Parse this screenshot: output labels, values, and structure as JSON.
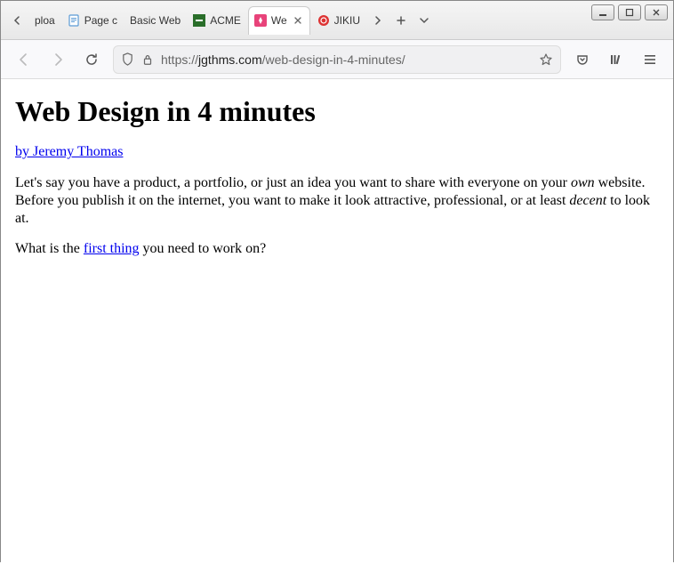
{
  "window": {
    "tabs": [
      {
        "label": "ploa",
        "favicon": "none"
      },
      {
        "label": "Page c",
        "favicon": "doc"
      },
      {
        "label": "Basic Web",
        "favicon": "none"
      },
      {
        "label": "ACME",
        "favicon": "acme"
      },
      {
        "label": "We",
        "favicon": "jt",
        "active": true
      },
      {
        "label": "JIKIU",
        "favicon": "spiral"
      }
    ]
  },
  "toolbar": {
    "url_prefix": "https://",
    "url_domain": "jgthms.com",
    "url_path": "/web-design-in-4-minutes/"
  },
  "page": {
    "title": "Web Design in 4 minutes",
    "byline": "by Jeremy Thomas",
    "p1_a": "Let's say you have a product, a portfolio, or just an idea you want to share with everyone on your ",
    "p1_em1": "own",
    "p1_b": " website. Before you publish it on the internet, you want to make it look attractive, professional, or at least ",
    "p1_em2": "decent",
    "p1_c": " to look at.",
    "p2_a": "What is the ",
    "p2_link": "first thing",
    "p2_b": " you need to work on?"
  }
}
